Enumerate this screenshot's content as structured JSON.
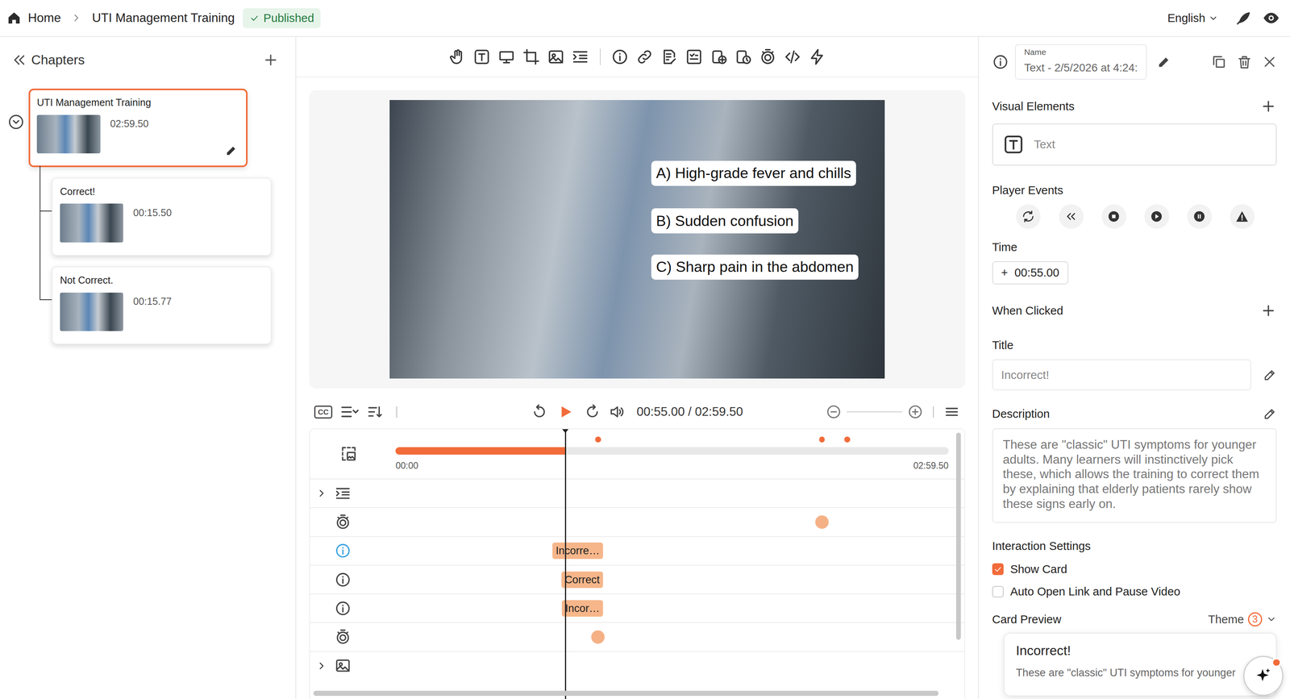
{
  "breadcrumb": {
    "home": "Home",
    "course": "UTI Management Training",
    "status": "Published"
  },
  "language": "English",
  "chapters": {
    "title": "Chapters",
    "expanded": true,
    "items": [
      {
        "title": "UTI Management Training",
        "duration": "02:59.50",
        "selected": true,
        "kind": "root"
      },
      {
        "title": "Correct!",
        "duration": "00:15.50",
        "selected": false,
        "kind": "child"
      },
      {
        "title": "Not Correct.",
        "duration": "00:15.77",
        "selected": false,
        "kind": "child"
      }
    ]
  },
  "video": {
    "options": [
      "A) High-grade fever and chills",
      "B) Sudden confusion",
      "C) Sharp pain in the abdomen"
    ]
  },
  "player": {
    "captions": "CC",
    "time": "00:55.00 / 02:59.50",
    "playing": false,
    "progress": {
      "level": 0.307
    },
    "start": "00:00",
    "end": "02:59.50"
  },
  "timeline": {
    "tracks": [
      {
        "kind": "chapters",
        "expanded": false,
        "selected": false
      },
      {
        "kind": "timer",
        "selected": false
      },
      {
        "kind": "info",
        "label": "Incorre…",
        "selected": true
      },
      {
        "kind": "info",
        "label": "Correct",
        "selected": false
      },
      {
        "kind": "info",
        "label": "Incor…",
        "selected": false
      },
      {
        "kind": "timer",
        "selected": false
      },
      {
        "kind": "image",
        "expanded": false,
        "selected": false
      }
    ]
  },
  "properties": {
    "name_label": "Name",
    "name": "Text - 2/5/2026 at 4:24:",
    "visual_elements": {
      "title": "Visual Elements",
      "items": [
        "Text"
      ]
    },
    "player_events": {
      "title": "Player Events"
    },
    "time": {
      "title": "Time",
      "prefix": "+",
      "value": "00:55.00"
    },
    "when_clicked": "When Clicked",
    "title": {
      "label": "Title",
      "value": "Incorrect!"
    },
    "description": {
      "label": "Description",
      "value": "These are \"classic\" UTI symptoms for younger adults. Many learners will instinctively pick these, which allows the training to correct them by explaining that elderly patients rarely show these signs early on."
    },
    "interaction": {
      "title": "Interaction Settings",
      "options": [
        {
          "label": "Show Card",
          "checked": true
        },
        {
          "label": "Auto Open Link and Pause Video",
          "checked": false
        }
      ]
    },
    "card_preview": {
      "title": "Card Preview",
      "theme": "Theme",
      "theme_count": "3",
      "card_title": "Incorrect!",
      "card_text": "These are \"classic\" UTI symptoms for younger"
    }
  }
}
